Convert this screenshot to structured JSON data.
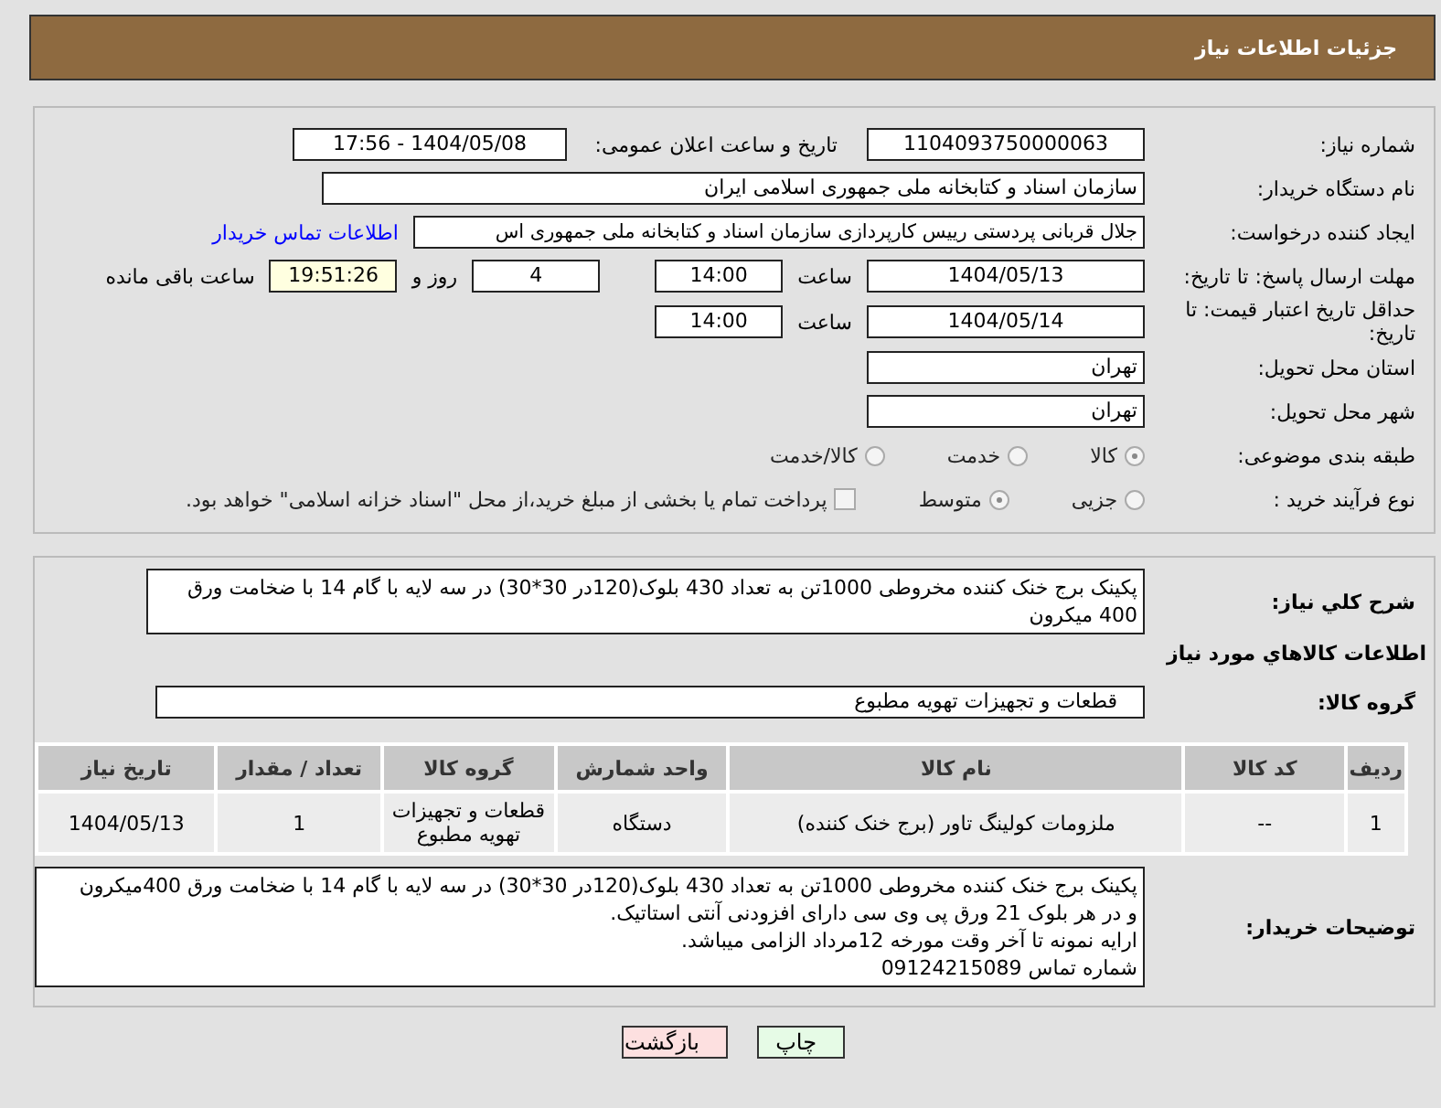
{
  "header": {
    "title": "جزئیات اطلاعات نیاز"
  },
  "need_number": {
    "label": "شماره نیاز:",
    "value": "1104093750000063"
  },
  "announce": {
    "label": "تاریخ و ساعت اعلان عمومی:",
    "value": "1404/05/08 - 17:56"
  },
  "buyer_org": {
    "label": "نام دستگاه خریدار:",
    "value": "سازمان اسناد و کتابخانه ملی جمهوری اسلامی ایران"
  },
  "requester": {
    "label": "ایجاد کننده درخواست:",
    "value": "جلال قربانی پردستی رییس کارپردازی سازمان اسناد و کتابخانه ملی جمهوری اس",
    "link": "اطلاعات تماس خریدار"
  },
  "reply_deadline": {
    "label": "مهلت ارسال پاسخ: تا تاریخ:",
    "date": "1404/05/13",
    "time_label": "ساعت",
    "time": "14:00",
    "days": "4",
    "days_label": "روز و",
    "remaining": "19:51:26",
    "remaining_label": "ساعت باقی مانده"
  },
  "price_validity": {
    "label": "حداقل تاریخ اعتبار قیمت: تا تاریخ:",
    "date": "1404/05/14",
    "time_label": "ساعت",
    "time": "14:00"
  },
  "province": {
    "label": "استان محل تحویل:",
    "value": "تهران"
  },
  "city": {
    "label": "شهر محل تحویل:",
    "value": "تهران"
  },
  "category": {
    "label": "طبقه بندی موضوعی:",
    "options": [
      {
        "label": "کالا",
        "selected": true
      },
      {
        "label": "خدمت",
        "selected": false
      },
      {
        "label": "کالا/خدمت",
        "selected": false
      }
    ]
  },
  "process": {
    "label": "نوع فرآیند خرید :",
    "options": [
      {
        "label": "جزیی",
        "selected": false
      },
      {
        "label": "متوسط",
        "selected": true
      }
    ],
    "payment_note": {
      "label": "پرداخت تمام یا بخشی از مبلغ خرید،از محل \"اسناد خزانه اسلامی\" خواهد بود.",
      "checked": false
    }
  },
  "description": {
    "label": "شرح کلي نياز:",
    "value": "پکینک برج خنک کننده مخروطی 1000تن به تعداد 430 بلوک(120در 30*30) در سه لایه با گام 14 با ضخامت ورق 400 میکرون"
  },
  "goods": {
    "title": "اطلاعات کالاهاي مورد نياز",
    "group_label": "گروه کالا:",
    "group_value": "قطعات و تجهیزات تهویه مطبوع",
    "columns": [
      "ردیف",
      "کد کالا",
      "نام کالا",
      "واحد شمارش",
      "گروه کالا",
      "تعداد / مقدار",
      "تاریخ نیاز"
    ],
    "rows": [
      [
        "1",
        "--",
        "ملزومات کولینگ تاور (برج خنک کننده)",
        "دستگاه",
        "قطعات و تجهیزات تهویه مطبوع",
        "1",
        "1404/05/13"
      ]
    ]
  },
  "buyer_notes": {
    "label": "توضیحات خریدار:",
    "lines": [
      "پکینک برج خنک کننده مخروطی 1000تن به تعداد 430 بلوک(120در 30*30) در سه لایه با گام 14 با ضخامت ورق 400میکرون",
      "و در هر بلوک 21 ورق پی وی سی دارای افزودنی آنتی استاتیک.",
      "ارایه نمونه تا آخر وقت مورخه 12مرداد الزامی میباشد.",
      "شماره تماس 09124215089"
    ]
  },
  "buttons": [
    {
      "label": "چاپ",
      "kind": "print"
    },
    {
      "label": "بازگشت",
      "kind": "back"
    }
  ]
}
